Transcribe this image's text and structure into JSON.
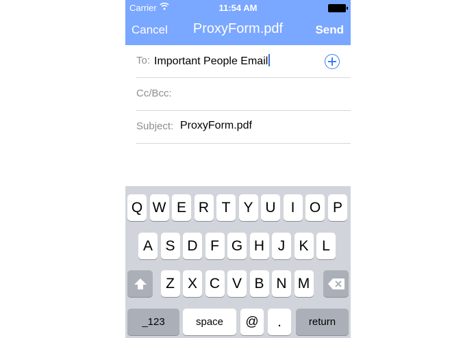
{
  "status_bar": {
    "carrier": "Carrier",
    "time": "11:54 AM"
  },
  "nav": {
    "cancel_label": "Cancel",
    "title": "ProxyForm.pdf",
    "send_label": "Send"
  },
  "fields": {
    "to": {
      "label": "To:",
      "value": "Important People Email"
    },
    "ccbcc": {
      "label": "Cc/Bcc:",
      "value": ""
    },
    "subject": {
      "label": "Subject:",
      "value": "ProxyForm.pdf"
    }
  },
  "keyboard": {
    "row1": [
      "Q",
      "W",
      "E",
      "R",
      "T",
      "Y",
      "U",
      "I",
      "O",
      "P"
    ],
    "row2": [
      "A",
      "S",
      "D",
      "F",
      "G",
      "H",
      "J",
      "K",
      "L"
    ],
    "row3": [
      "Z",
      "X",
      "C",
      "V",
      "B",
      "N",
      "M"
    ],
    "numbers_label": "_123",
    "space_label": "space",
    "at_label": "@",
    "dot_label": ".",
    "return_label": "return"
  },
  "colors": {
    "nav_bg": "#7aa7ff",
    "accent": "#3b7cf0",
    "keyboard_bg": "#d1d5db"
  }
}
